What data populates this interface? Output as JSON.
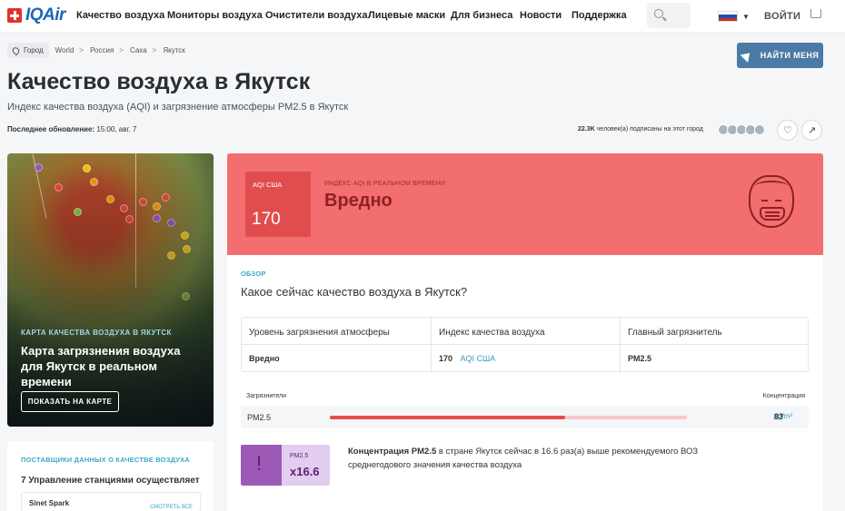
{
  "brand": {
    "name": "IQAir"
  },
  "nav": {
    "items": [
      "Качество воздуха",
      "Мониторы воздуха",
      "Очистители воздуха",
      "Лицевые маски",
      "Для бизнеса",
      "Новости",
      "Поддержка"
    ],
    "login": "ВОЙТИ"
  },
  "breadcrumb": {
    "city_label": "Город",
    "items": [
      "World",
      "Россия",
      "Саха",
      "Якутск"
    ],
    "separator": ">"
  },
  "find_me": "НАЙТИ МЕНЯ",
  "page": {
    "title": "Качество воздуха в Якутск",
    "subtitle": "Индекс качества воздуха (AQI) и загрязнение атмосферы PM2.5 в Якутск",
    "updated_label": "Последнее обновление:",
    "updated_value": "15:00, авг. 7",
    "subscribers_count": "22.3K",
    "subscribers_text": "человек(а) подписаны на этот город"
  },
  "map": {
    "label": "КАРТА КАЧЕСТВА ВОЗДУХА В ЯКУТСК",
    "title": "Карта загрязнения воздуха для Якутск в реальном времени",
    "button": "ПОКАЗАТЬ НА КАРТЕ"
  },
  "providers": {
    "heading": "ПОСТАВЩИКИ ДАННЫХ О КАЧЕСТВЕ ВОЗДУХА",
    "subtitle": "7 Управление станциями осуществляет",
    "first_item": "Sinet Spark",
    "link": "СМОТРЕТЬ ВСЕ"
  },
  "aqi": {
    "label": "AQI США",
    "value": "170",
    "realtime_label": "ИНДЕКС AQI В РЕАЛЬНОМ ВРЕМЕНИ",
    "status": "Вредно",
    "accent": "#f36e6e"
  },
  "overview": {
    "label": "ОБЗОР",
    "title": "Какое сейчас качество воздуха в Якутск?",
    "columns": [
      "Уровень загрязнения атмосферы",
      "Индекс качества воздуха",
      "Главный загрязнитель"
    ],
    "values": {
      "level": "Вредно",
      "index": "170",
      "index_unit": "AQI США",
      "main": "PM2.5"
    }
  },
  "pollutants": {
    "header_left": "Загрязнители",
    "header_right": "Концентрация",
    "rows": [
      {
        "name": "PM2.5",
        "value": "83",
        "unit": "µg/m³",
        "fill": 0.66
      }
    ]
  },
  "highlight": {
    "pm_label": "PM2.5",
    "value": "x16.6",
    "text_bold": "Концентрация PM2.5",
    "text": "в стране Якутск сейчас в 16.6 раз(а) выше рекомендуемого ВОЗ среднегодового значения качества воздуха"
  }
}
